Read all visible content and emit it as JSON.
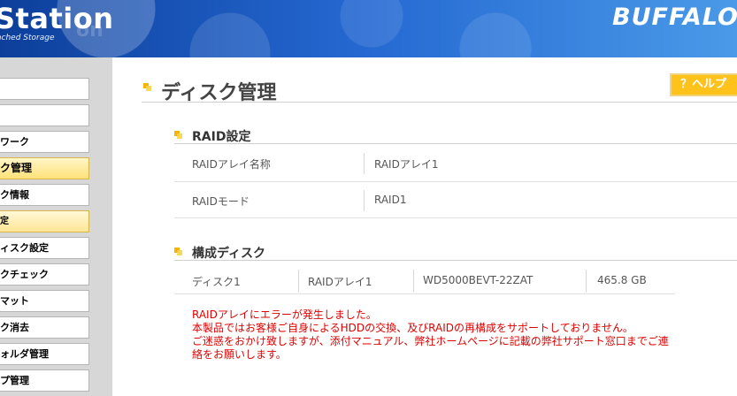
{
  "header": {
    "product_name": "Station",
    "product_sub": "ached Storage",
    "watermark": "on",
    "brand_logo": "BUFFALO"
  },
  "sidebar": {
    "items": [
      {
        "label": "",
        "state": "normal"
      },
      {
        "label": "",
        "state": "normal"
      },
      {
        "label": "ワーク",
        "state": "normal"
      },
      {
        "label": "ク管理",
        "state": "active"
      },
      {
        "label": "ク情報",
        "state": "normal"
      },
      {
        "label": "定",
        "state": "subactive"
      },
      {
        "label": "ィスク設定",
        "state": "normal"
      },
      {
        "label": "クチェック",
        "state": "normal"
      },
      {
        "label": "マット",
        "state": "normal"
      },
      {
        "label": "ク消去",
        "state": "normal"
      },
      {
        "label": "ォルダ管理",
        "state": "normal"
      },
      {
        "label": "プ管理",
        "state": "normal"
      }
    ]
  },
  "main": {
    "page_title": "ディスク管理",
    "help_label": "？ヘルプ",
    "raid_section": {
      "title": "RAID設定",
      "rows": [
        {
          "label": "RAIDアレイ名称",
          "value": "RAIDアレイ1"
        },
        {
          "label": "RAIDモード",
          "value": "RAID1"
        }
      ]
    },
    "disk_section": {
      "title": "構成ディスク",
      "rows": [
        {
          "disk": "ディスク1",
          "array": "RAIDアレイ1",
          "model": "WD5000BEVT-22ZAT",
          "size": "465.8 GB"
        }
      ]
    },
    "error_lines": [
      "RAIDアレイにエラーが発生しました。",
      "本製品ではお客様ご自身によるHDDの交換、及びRAIDの再構成をサポートしておりません。",
      "ご迷惑をおかけ致しますが、添付マニュアル、弊社ホームページに記載の弊社サポート窓口までご連",
      "絡をお願いします。"
    ]
  },
  "colors": {
    "header_blue": "#2569d2",
    "accent_yellow": "#ffc21a",
    "error_red": "#e00000",
    "sidebar_gray": "#d7d7d7"
  }
}
